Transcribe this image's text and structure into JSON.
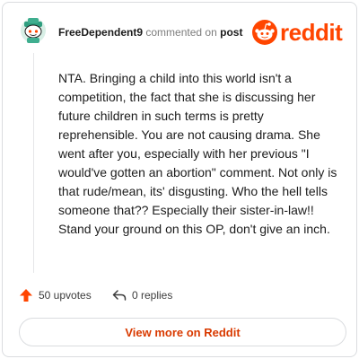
{
  "header": {
    "username": "FreeDependent9",
    "action_text": "commented on",
    "post_link": "post",
    "logo_text": "reddit"
  },
  "comment": {
    "body": "NTA. Bringing a child into this world isn't a competition, the fact that she is discussing her future children in such terms is pretty reprehensible. You are not causing drama. She went after you, especially with her previous \"I would've gotten an abortion\" comment. Not only is that rude/mean, its' disgusting. Who the hell tells someone that?? Especially their sister-in-law!! Stand your ground on this OP, don't give an inch."
  },
  "actions": {
    "upvotes": "50 upvotes",
    "replies": "0 replies"
  },
  "footer": {
    "view_more": "View more on Reddit"
  },
  "icons": {
    "avatar": "snoo-avatar-icon",
    "logo": "reddit-snoo-icon",
    "upvote": "upvote-arrow-icon",
    "reply": "reply-arrow-icon"
  },
  "colors": {
    "brand": "#ff4500",
    "view_more_text": "#d93a00",
    "avatar_bg": "#3fae8f"
  }
}
